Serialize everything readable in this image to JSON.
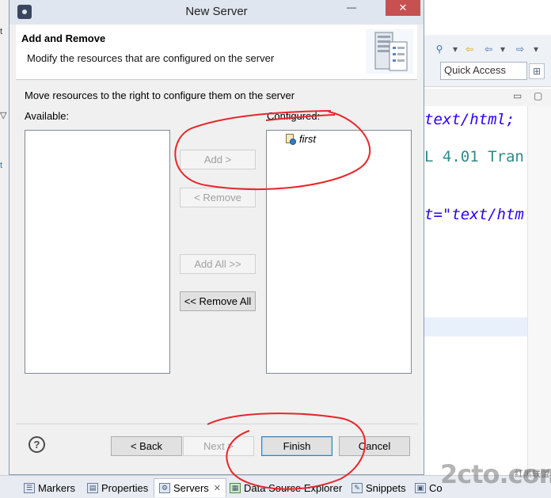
{
  "dialog": {
    "title": "New Server",
    "minimize_symbol": "—",
    "close_symbol": "✕",
    "header_title": "Add and Remove",
    "header_description": "Modify the resources that are configured on the server",
    "instruction": "Move resources to the right to configure them on the server",
    "available_label": "Available:",
    "configured_label": "Configured:",
    "configured_items": [
      "first"
    ],
    "transfer_buttons": {
      "add": "Add >",
      "remove": "< Remove",
      "add_all": "Add All >>",
      "remove_all": "<< Remove All"
    },
    "footer_buttons": {
      "help": "?",
      "back": "< Back",
      "next": "Next >",
      "finish": "Finish",
      "cancel": "Cancel"
    }
  },
  "ide": {
    "left_fragments": [
      "t",
      "▽",
      "t"
    ],
    "quick_access": "Quick Access",
    "code_lines": [
      {
        "text": "text/html;",
        "color": "#2a00ff"
      },
      {
        "text": "L 4.01 Tran",
        "color": "#2e8b8b"
      },
      {
        "text": "t=\"text/htm",
        "color": "#2a00ff"
      }
    ],
    "bottom_tabs": [
      {
        "label": "Markers",
        "icon": "markers-icon"
      },
      {
        "label": "Properties",
        "icon": "properties-icon"
      },
      {
        "label": "Servers",
        "icon": "servers-icon",
        "active": true
      },
      {
        "label": "Data Source Explorer",
        "icon": "data-source-icon"
      },
      {
        "label": "Snippets",
        "icon": "snippets-icon"
      },
      {
        "label": "Co",
        "icon": "console-icon"
      }
    ],
    "tab_close_symbol": "✕",
    "watermark": {
      "main": "2cto.com",
      "small": "红黑联盟"
    }
  },
  "colors": {
    "annotation": "#e8262a",
    "dialog_bg": "#f0f0f0",
    "close_button": "#c75050"
  }
}
